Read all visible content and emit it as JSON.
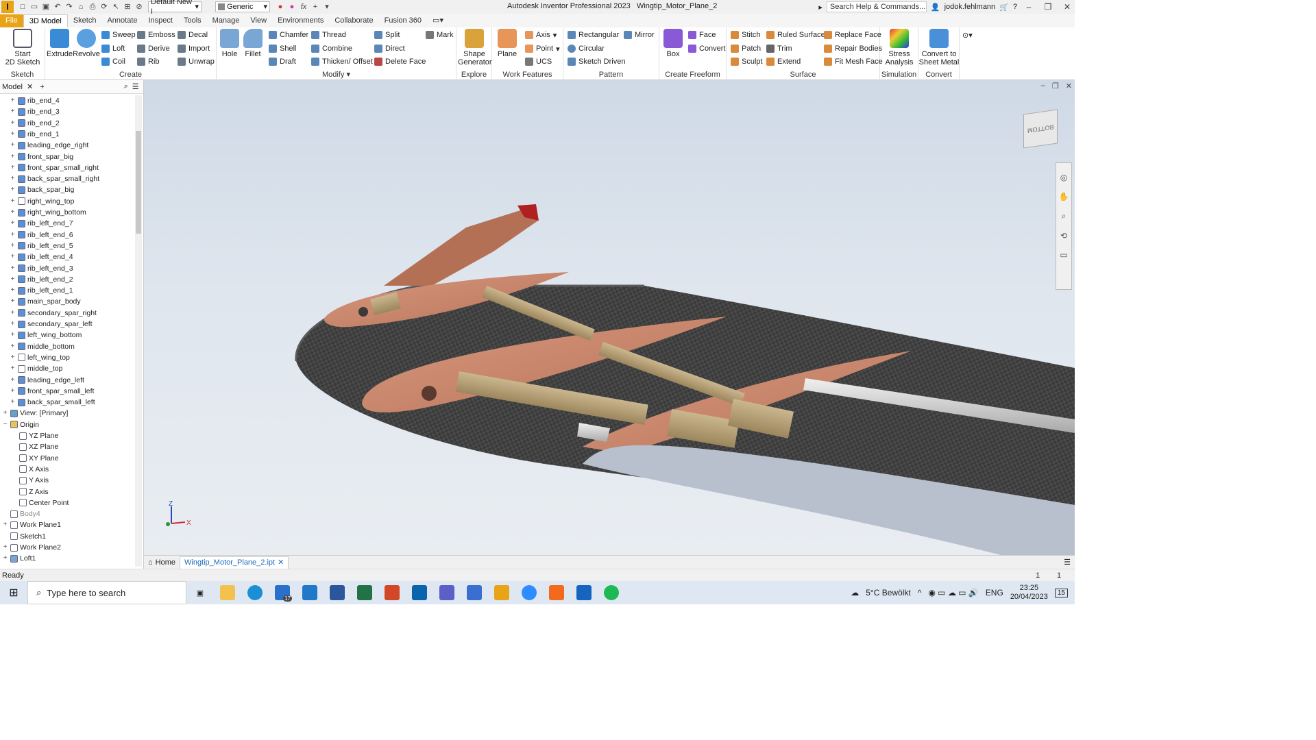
{
  "titlebar": {
    "app_title": "Autodesk Inventor Professional 2023",
    "doc_title": "Wingtip_Motor_Plane_2",
    "project_combo": "Default New I",
    "appearance_combo": "Generic",
    "search_placeholder": "Search Help & Commands...",
    "user": "jodok.fehlmann"
  },
  "tabs": [
    "File",
    "3D Model",
    "Sketch",
    "Annotate",
    "Inspect",
    "Tools",
    "Manage",
    "View",
    "Environments",
    "Collaborate",
    "Fusion 360"
  ],
  "ribbon": {
    "sketch": {
      "title": "Sketch",
      "start": "Start",
      "start2": "2D Sketch"
    },
    "create": {
      "title": "Create",
      "extrude": "Extrude",
      "revolve": "Revolve",
      "sweep": "Sweep",
      "emboss": "Emboss",
      "decal": "Decal",
      "loft": "Loft",
      "derive": "Derive",
      "import": "Import",
      "coil": "Coil",
      "rib": "Rib",
      "unwrap": "Unwrap"
    },
    "modify": {
      "title": "Modify",
      "hole": "Hole",
      "fillet": "Fillet",
      "chamfer": "Chamfer",
      "thread": "Thread",
      "split": "Split",
      "mark": "Mark",
      "shell": "Shell",
      "combine": "Combine",
      "direct": "Direct",
      "draft": "Draft",
      "thicken": "Thicken/ Offset",
      "delete_face": "Delete Face"
    },
    "explore": {
      "title": "Explore",
      "shape": "Shape",
      "shape2": "Generator"
    },
    "work_features": {
      "title": "Work Features",
      "plane": "Plane",
      "axis": "Axis",
      "point": "Point",
      "ucs": "UCS"
    },
    "pattern": {
      "title": "Pattern",
      "rectangular": "Rectangular",
      "mirror": "Mirror",
      "circular": "Circular",
      "sketch_driven": "Sketch Driven"
    },
    "freeform": {
      "title": "Create Freeform",
      "box": "Box",
      "face": "Face",
      "convert": "Convert"
    },
    "surface": {
      "title": "Surface",
      "stitch": "Stitch",
      "ruled": "Ruled Surface",
      "replace": "Replace Face",
      "patch": "Patch",
      "trim": "Trim",
      "repair": "Repair Bodies",
      "sculpt": "Sculpt",
      "extend": "Extend",
      "fit_mesh": "Fit Mesh Face"
    },
    "simulation": {
      "title": "Simulation",
      "stress": "Stress",
      "stress2": "Analysis"
    },
    "convert": {
      "title": "Convert",
      "sheet": "Convert to",
      "sheet2": "Sheet Metal"
    }
  },
  "browser": {
    "tab": "Model",
    "nodes": [
      {
        "label": "rib_end_4",
        "kind": "solid"
      },
      {
        "label": "rib_end_3",
        "kind": "solid"
      },
      {
        "label": "rib_end_2",
        "kind": "solid"
      },
      {
        "label": "rib_end_1",
        "kind": "solid"
      },
      {
        "label": "leading_edge_right",
        "kind": "solid"
      },
      {
        "label": "front_spar_big",
        "kind": "solid"
      },
      {
        "label": "front_spar_small_right",
        "kind": "solid"
      },
      {
        "label": "back_spar_small_right",
        "kind": "solid"
      },
      {
        "label": "back_spar_big",
        "kind": "solid"
      },
      {
        "label": "right_wing_top",
        "kind": "surface"
      },
      {
        "label": "right_wing_bottom",
        "kind": "solid"
      },
      {
        "label": "rib_left_end_7",
        "kind": "solid"
      },
      {
        "label": "rib_left_end_6",
        "kind": "solid"
      },
      {
        "label": "rib_left_end_5",
        "kind": "solid"
      },
      {
        "label": "rib_left_end_4",
        "kind": "solid"
      },
      {
        "label": "rib_left_end_3",
        "kind": "solid"
      },
      {
        "label": "rib_left_end_2",
        "kind": "solid"
      },
      {
        "label": "rib_left_end_1",
        "kind": "solid"
      },
      {
        "label": "main_spar_body",
        "kind": "solid"
      },
      {
        "label": "secondary_spar_right",
        "kind": "solid"
      },
      {
        "label": "secondary_spar_left",
        "kind": "solid"
      },
      {
        "label": "left_wing_bottom",
        "kind": "solid"
      },
      {
        "label": "middle_bottom",
        "kind": "solid"
      },
      {
        "label": "left_wing_top",
        "kind": "surface"
      },
      {
        "label": "middle_top",
        "kind": "surface"
      },
      {
        "label": "leading_edge_left",
        "kind": "solid"
      },
      {
        "label": "front_spar_small_left",
        "kind": "solid"
      },
      {
        "label": "back_spar_small_left",
        "kind": "solid"
      },
      {
        "label": "View: [Primary]",
        "kind": "view"
      },
      {
        "label": "Origin",
        "kind": "folder"
      },
      {
        "label": "YZ Plane",
        "kind": "plane"
      },
      {
        "label": "XZ Plane",
        "kind": "plane"
      },
      {
        "label": "XY Plane",
        "kind": "plane"
      },
      {
        "label": "X Axis",
        "kind": "axis"
      },
      {
        "label": "Y Axis",
        "kind": "axis"
      },
      {
        "label": "Z Axis",
        "kind": "axis"
      },
      {
        "label": "Center Point",
        "kind": "point"
      },
      {
        "label": "Body4",
        "kind": "body"
      },
      {
        "label": "Work Plane1",
        "kind": "plane"
      },
      {
        "label": "Sketch1",
        "kind": "sketch"
      },
      {
        "label": "Work Plane2",
        "kind": "plane"
      },
      {
        "label": "Loft1",
        "kind": "feature"
      }
    ]
  },
  "viewcube": {
    "face": "BOTTOM"
  },
  "triad": {
    "z": "Z",
    "x": "X"
  },
  "doctabs": {
    "home": "Home",
    "active": "Wingtip_Motor_Plane_2.ipt"
  },
  "status": {
    "text": "Ready",
    "count1": "1",
    "count2": "1"
  },
  "taskbar": {
    "search_placeholder": "Type here to search",
    "mail_badge": "17",
    "weather": "5°C  Bewölkt",
    "lang": "ENG",
    "time": "23:25",
    "date": "20/04/2023",
    "notif": "15"
  }
}
